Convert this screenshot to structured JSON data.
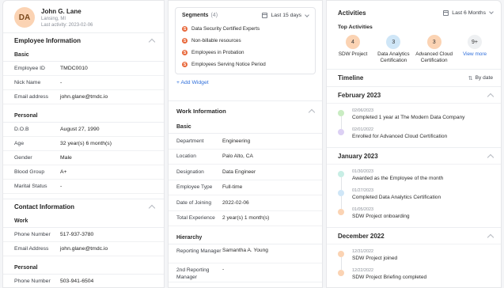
{
  "profile": {
    "initials": "DA",
    "name": "John G. Lane",
    "location": "Lansing, MI",
    "last_activity": "Last activity: 2023-02-06"
  },
  "employee_info": {
    "title": "Employee Information",
    "basic_label": "Basic",
    "basic": [
      {
        "k": "Employee ID",
        "v": "TMDC0010"
      },
      {
        "k": "Nick Name",
        "v": "-"
      },
      {
        "k": "Email address",
        "v": "john.glane@tmdc.io"
      }
    ],
    "personal_label": "Personal",
    "personal": [
      {
        "k": "D.O.B",
        "v": "August 27, 1990"
      },
      {
        "k": "Age",
        "v": "32 year(s) 6 month(s)"
      },
      {
        "k": "Gender",
        "v": "Male"
      },
      {
        "k": "Blood Group",
        "v": "A+"
      },
      {
        "k": "Marital Status",
        "v": "-"
      }
    ]
  },
  "contact_info": {
    "title": "Contact Information",
    "work_label": "Work",
    "work": [
      {
        "k": "Phone Number",
        "v": "517-937-3780"
      },
      {
        "k": "Email Address",
        "v": "john.glane@tmdc.io"
      }
    ],
    "personal_label": "Personal",
    "personal": [
      {
        "k": "Phone Number",
        "v": "503-941-6504"
      }
    ]
  },
  "segments": {
    "title": "Segments",
    "count": "(4)",
    "date_range": "Last 15 days",
    "items": [
      {
        "icon": "S",
        "label": "Data Security Certified Experts"
      },
      {
        "icon": "S",
        "label": "Non-billable resources"
      },
      {
        "icon": "S",
        "label": "Employees in Probation"
      },
      {
        "icon": "S",
        "label": "Employees Serving Notice Period"
      }
    ],
    "add_widget": "+ Add Widget"
  },
  "work_info": {
    "title": "Work Information",
    "basic_label": "Basic",
    "basic": [
      {
        "k": "Department",
        "v": "Engineering"
      },
      {
        "k": "Location",
        "v": "Palo Alto, CA"
      },
      {
        "k": "Designation",
        "v": "Data Engineer"
      },
      {
        "k": "Employee Type",
        "v": "Full-time"
      },
      {
        "k": "Date of Joining",
        "v": "2022-02-06"
      },
      {
        "k": "Total Experience",
        "v": "2 year(s) 1 month(s)"
      }
    ],
    "hierarchy_label": "Hierarchy",
    "reporting_manager_k": "Reporting Manager",
    "reporting_manager_v": "Samantha A. Young",
    "second_reporting_k": "2nd Reporting Manager",
    "second_reporting_v": "-"
  },
  "activities": {
    "title": "Activities",
    "date_range": "Last 6 Months",
    "top_sections_label": "Top Activities",
    "top": [
      {
        "count": "4",
        "label": "SDW Project",
        "color": "#fbd3b3"
      },
      {
        "count": "3",
        "label": "Data Analytics Certification",
        "color": "#cfe6f7"
      },
      {
        "count": "3",
        "label": "Advanced Cloud Certification",
        "color": "#fbd3b3"
      },
      {
        "count": "9+",
        "label": "View more",
        "color": "#eef0f2"
      }
    ]
  },
  "timeline": {
    "title": "Timeline",
    "sort_label": "By date",
    "months": [
      {
        "name": "February 2023",
        "events": [
          {
            "date": "02/06/2023",
            "title": "Completed 1 year at The Modern Data Company",
            "color": "#c9ecc2"
          },
          {
            "date": "02/01/2022",
            "title": "Enrolled for Advanced Cloud Certification",
            "color": "#dcd0f4"
          }
        ]
      },
      {
        "name": "January 2023",
        "events": [
          {
            "date": "01/30/2023",
            "title": "Awarded as the Employee of the month",
            "color": "#c8eee5"
          },
          {
            "date": "01/27/2023",
            "title": "Completed Data Analytics Certification",
            "color": "#cfe6f7"
          },
          {
            "date": "01/05/2023",
            "title": "SDW Project onboarding",
            "color": "#fbd3b3"
          }
        ]
      },
      {
        "name": "December 2022",
        "events": [
          {
            "date": "12/31/2022",
            "title": "SDW Project joined",
            "color": "#fbd3b3"
          },
          {
            "date": "12/22/2022",
            "title": "SDW Project Briefing completed",
            "color": "#fbd3b3"
          }
        ]
      }
    ]
  }
}
